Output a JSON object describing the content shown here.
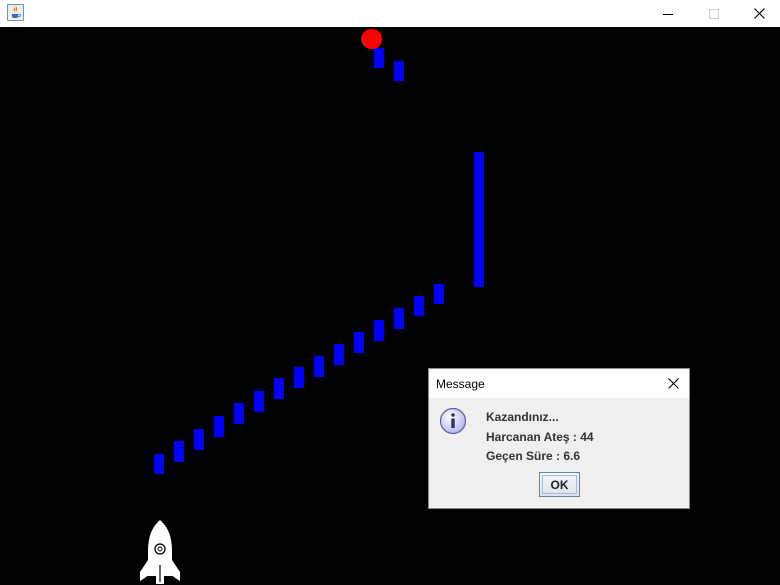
{
  "window": {
    "title": "",
    "icons": {
      "app": "java-cup-icon",
      "minimize": "minimize-icon",
      "maximize": "maximize-icon",
      "close": "close-icon"
    }
  },
  "game": {
    "background": "#000000",
    "block_color": "#0000ff",
    "ball_color": "#ff0000",
    "player": "rocket-icon"
  },
  "dialog": {
    "title": "Message",
    "icon": "info-icon",
    "lines": [
      "Kazandınız...",
      "Harcanan Ateş : 44",
      "Geçen Süre : 6.6"
    ],
    "ok_label": "OK"
  }
}
